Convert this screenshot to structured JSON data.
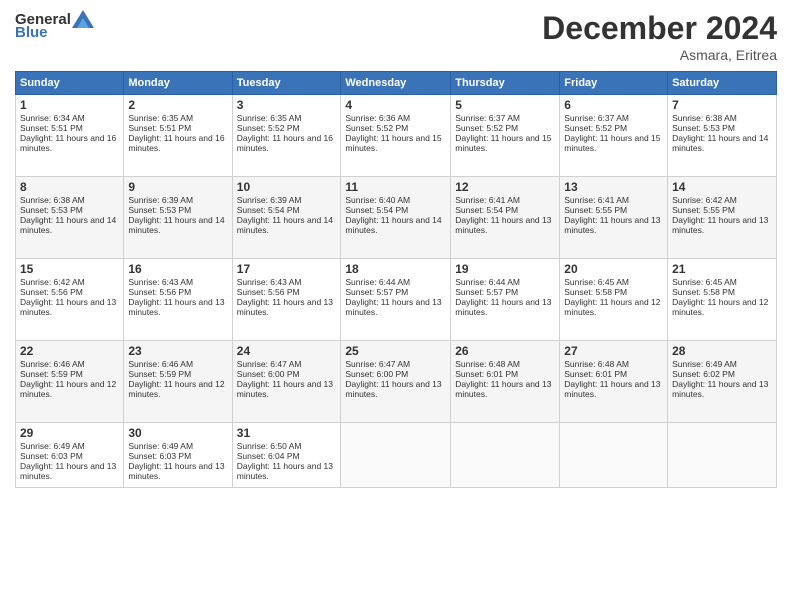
{
  "header": {
    "logo_general": "General",
    "logo_blue": "Blue",
    "title": "December 2024",
    "location": "Asmara, Eritrea"
  },
  "days_of_week": [
    "Sunday",
    "Monday",
    "Tuesday",
    "Wednesday",
    "Thursday",
    "Friday",
    "Saturday"
  ],
  "weeks": [
    [
      {
        "day": "1",
        "sunrise": "Sunrise: 6:34 AM",
        "sunset": "Sunset: 5:51 PM",
        "daylight": "Daylight: 11 hours and 16 minutes."
      },
      {
        "day": "2",
        "sunrise": "Sunrise: 6:35 AM",
        "sunset": "Sunset: 5:51 PM",
        "daylight": "Daylight: 11 hours and 16 minutes."
      },
      {
        "day": "3",
        "sunrise": "Sunrise: 6:35 AM",
        "sunset": "Sunset: 5:52 PM",
        "daylight": "Daylight: 11 hours and 16 minutes."
      },
      {
        "day": "4",
        "sunrise": "Sunrise: 6:36 AM",
        "sunset": "Sunset: 5:52 PM",
        "daylight": "Daylight: 11 hours and 15 minutes."
      },
      {
        "day": "5",
        "sunrise": "Sunrise: 6:37 AM",
        "sunset": "Sunset: 5:52 PM",
        "daylight": "Daylight: 11 hours and 15 minutes."
      },
      {
        "day": "6",
        "sunrise": "Sunrise: 6:37 AM",
        "sunset": "Sunset: 5:52 PM",
        "daylight": "Daylight: 11 hours and 15 minutes."
      },
      {
        "day": "7",
        "sunrise": "Sunrise: 6:38 AM",
        "sunset": "Sunset: 5:53 PM",
        "daylight": "Daylight: 11 hours and 14 minutes."
      }
    ],
    [
      {
        "day": "8",
        "sunrise": "Sunrise: 6:38 AM",
        "sunset": "Sunset: 5:53 PM",
        "daylight": "Daylight: 11 hours and 14 minutes."
      },
      {
        "day": "9",
        "sunrise": "Sunrise: 6:39 AM",
        "sunset": "Sunset: 5:53 PM",
        "daylight": "Daylight: 11 hours and 14 minutes."
      },
      {
        "day": "10",
        "sunrise": "Sunrise: 6:39 AM",
        "sunset": "Sunset: 5:54 PM",
        "daylight": "Daylight: 11 hours and 14 minutes."
      },
      {
        "day": "11",
        "sunrise": "Sunrise: 6:40 AM",
        "sunset": "Sunset: 5:54 PM",
        "daylight": "Daylight: 11 hours and 14 minutes."
      },
      {
        "day": "12",
        "sunrise": "Sunrise: 6:41 AM",
        "sunset": "Sunset: 5:54 PM",
        "daylight": "Daylight: 11 hours and 13 minutes."
      },
      {
        "day": "13",
        "sunrise": "Sunrise: 6:41 AM",
        "sunset": "Sunset: 5:55 PM",
        "daylight": "Daylight: 11 hours and 13 minutes."
      },
      {
        "day": "14",
        "sunrise": "Sunrise: 6:42 AM",
        "sunset": "Sunset: 5:55 PM",
        "daylight": "Daylight: 11 hours and 13 minutes."
      }
    ],
    [
      {
        "day": "15",
        "sunrise": "Sunrise: 6:42 AM",
        "sunset": "Sunset: 5:56 PM",
        "daylight": "Daylight: 11 hours and 13 minutes."
      },
      {
        "day": "16",
        "sunrise": "Sunrise: 6:43 AM",
        "sunset": "Sunset: 5:56 PM",
        "daylight": "Daylight: 11 hours and 13 minutes."
      },
      {
        "day": "17",
        "sunrise": "Sunrise: 6:43 AM",
        "sunset": "Sunset: 5:56 PM",
        "daylight": "Daylight: 11 hours and 13 minutes."
      },
      {
        "day": "18",
        "sunrise": "Sunrise: 6:44 AM",
        "sunset": "Sunset: 5:57 PM",
        "daylight": "Daylight: 11 hours and 13 minutes."
      },
      {
        "day": "19",
        "sunrise": "Sunrise: 6:44 AM",
        "sunset": "Sunset: 5:57 PM",
        "daylight": "Daylight: 11 hours and 13 minutes."
      },
      {
        "day": "20",
        "sunrise": "Sunrise: 6:45 AM",
        "sunset": "Sunset: 5:58 PM",
        "daylight": "Daylight: 11 hours and 12 minutes."
      },
      {
        "day": "21",
        "sunrise": "Sunrise: 6:45 AM",
        "sunset": "Sunset: 5:58 PM",
        "daylight": "Daylight: 11 hours and 12 minutes."
      }
    ],
    [
      {
        "day": "22",
        "sunrise": "Sunrise: 6:46 AM",
        "sunset": "Sunset: 5:59 PM",
        "daylight": "Daylight: 11 hours and 12 minutes."
      },
      {
        "day": "23",
        "sunrise": "Sunrise: 6:46 AM",
        "sunset": "Sunset: 5:59 PM",
        "daylight": "Daylight: 11 hours and 12 minutes."
      },
      {
        "day": "24",
        "sunrise": "Sunrise: 6:47 AM",
        "sunset": "Sunset: 6:00 PM",
        "daylight": "Daylight: 11 hours and 13 minutes."
      },
      {
        "day": "25",
        "sunrise": "Sunrise: 6:47 AM",
        "sunset": "Sunset: 6:00 PM",
        "daylight": "Daylight: 11 hours and 13 minutes."
      },
      {
        "day": "26",
        "sunrise": "Sunrise: 6:48 AM",
        "sunset": "Sunset: 6:01 PM",
        "daylight": "Daylight: 11 hours and 13 minutes."
      },
      {
        "day": "27",
        "sunrise": "Sunrise: 6:48 AM",
        "sunset": "Sunset: 6:01 PM",
        "daylight": "Daylight: 11 hours and 13 minutes."
      },
      {
        "day": "28",
        "sunrise": "Sunrise: 6:49 AM",
        "sunset": "Sunset: 6:02 PM",
        "daylight": "Daylight: 11 hours and 13 minutes."
      }
    ],
    [
      {
        "day": "29",
        "sunrise": "Sunrise: 6:49 AM",
        "sunset": "Sunset: 6:03 PM",
        "daylight": "Daylight: 11 hours and 13 minutes."
      },
      {
        "day": "30",
        "sunrise": "Sunrise: 6:49 AM",
        "sunset": "Sunset: 6:03 PM",
        "daylight": "Daylight: 11 hours and 13 minutes."
      },
      {
        "day": "31",
        "sunrise": "Sunrise: 6:50 AM",
        "sunset": "Sunset: 6:04 PM",
        "daylight": "Daylight: 11 hours and 13 minutes."
      },
      null,
      null,
      null,
      null
    ]
  ]
}
